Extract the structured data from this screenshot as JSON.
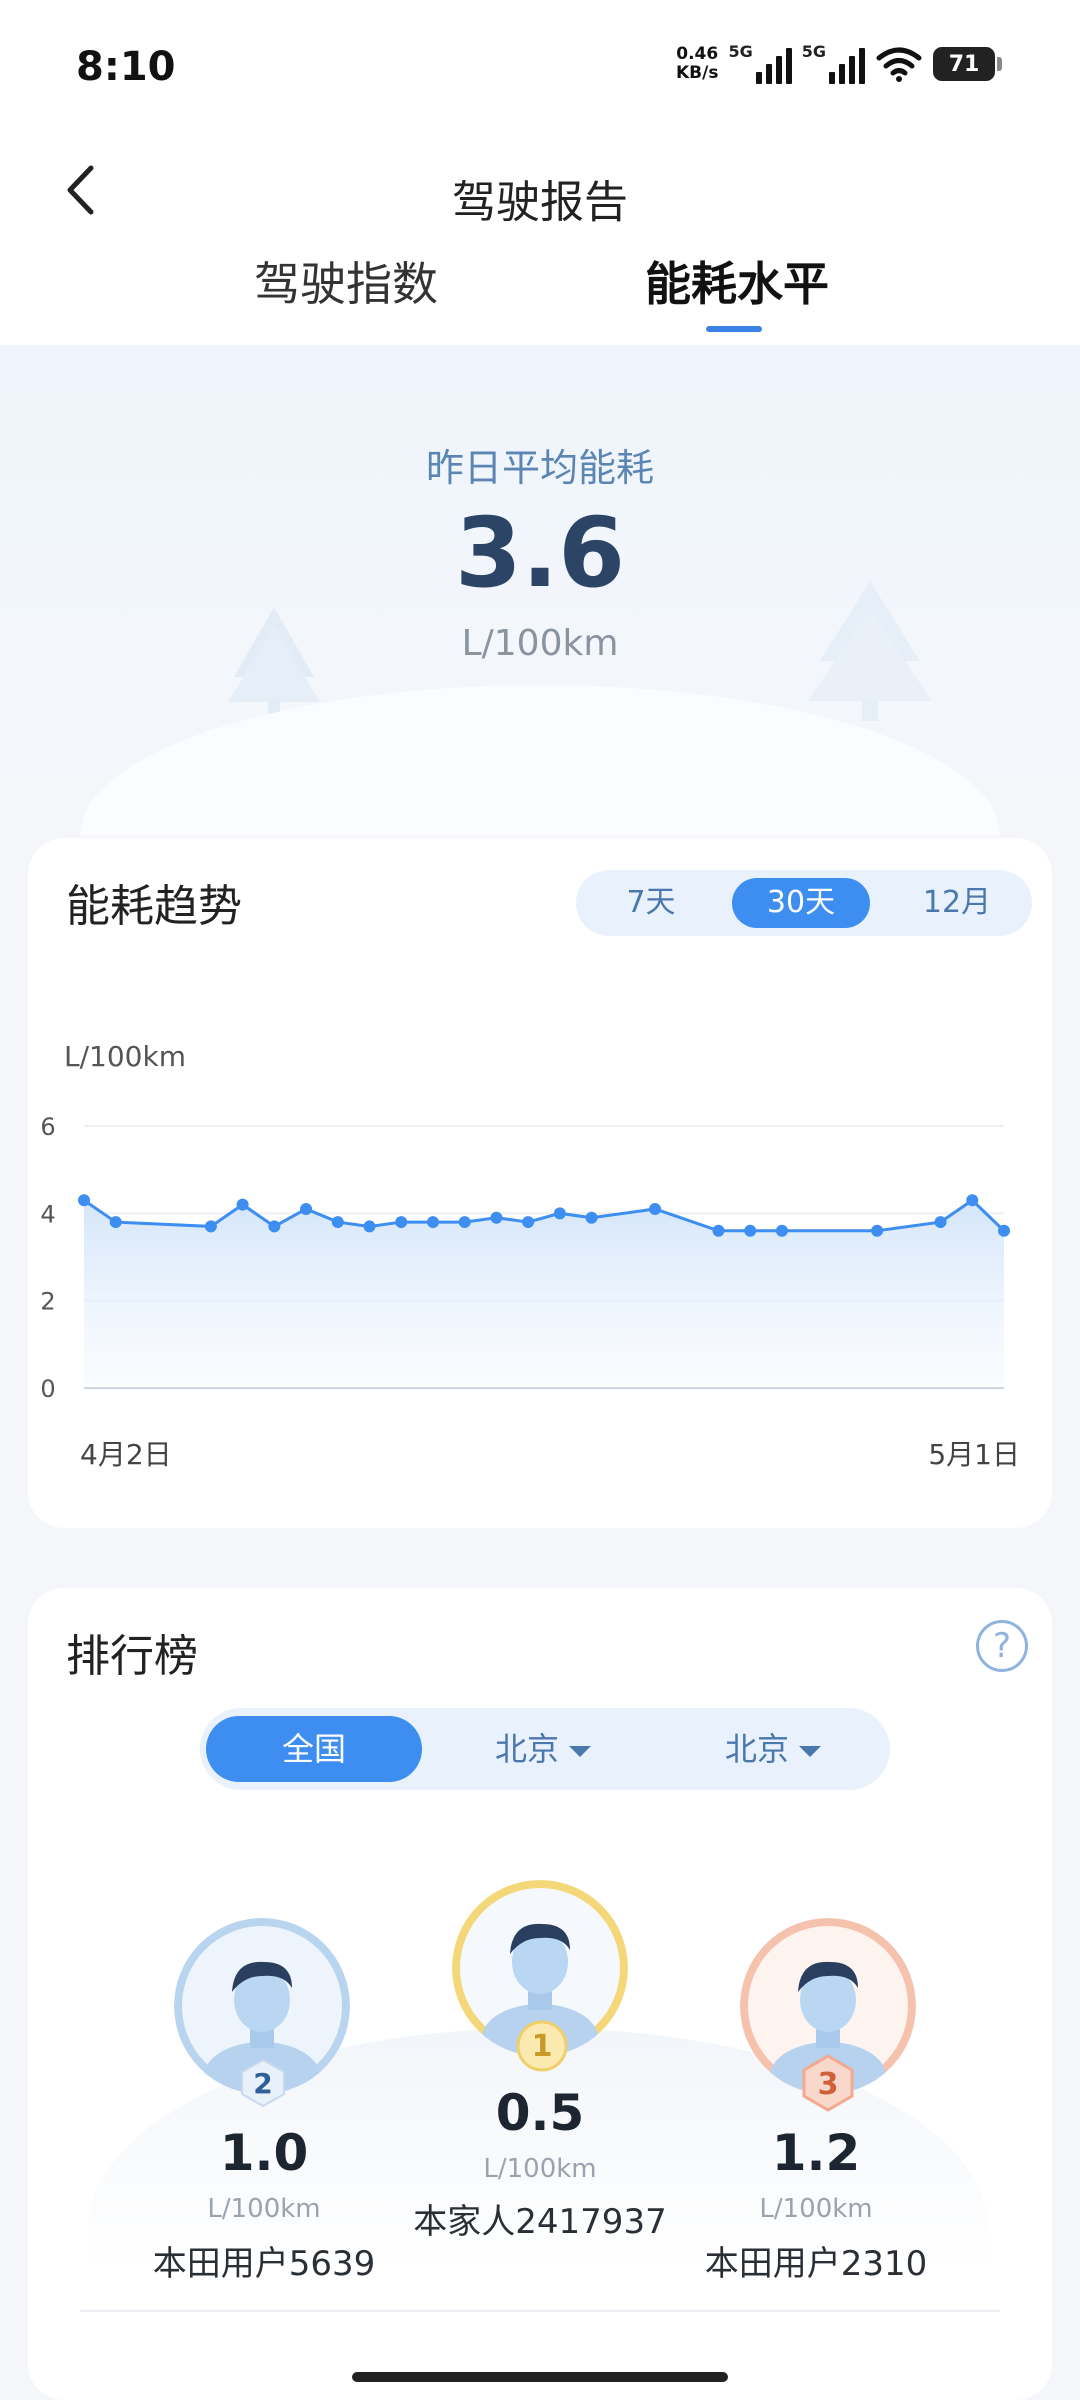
{
  "status_bar": {
    "time": "8:10",
    "net_speed_value": "0.46",
    "net_speed_unit": "KB/s",
    "signal1_label": "5G",
    "signal2_label": "5G",
    "battery": "71"
  },
  "header": {
    "title": "驾驶报告",
    "tabs": [
      {
        "label": "驾驶指数",
        "active": false
      },
      {
        "label": "能耗水平",
        "active": true
      }
    ]
  },
  "hero": {
    "label": "昨日平均能耗",
    "value": "3.6",
    "unit": "L/100km"
  },
  "trend": {
    "title": "能耗趋势",
    "periods": [
      "7天",
      "30天",
      "12月"
    ],
    "selected_period": "30天"
  },
  "chart_data": {
    "type": "area",
    "ylabel": "L/100km",
    "ylim": [
      0,
      6
    ],
    "yticks": [
      "6",
      "4",
      "2",
      "0"
    ],
    "x_start_label": "4月2日",
    "x_end_label": "5月1日",
    "x": [
      1,
      2,
      5,
      6,
      7,
      8,
      9,
      10,
      11,
      12,
      13,
      14,
      15,
      16,
      17,
      19,
      21,
      22,
      23,
      26,
      28,
      29,
      30
    ],
    "values": [
      4.3,
      3.8,
      3.7,
      4.2,
      3.7,
      4.1,
      3.8,
      3.7,
      3.8,
      3.8,
      3.8,
      3.9,
      3.8,
      4.0,
      3.9,
      4.1,
      3.6,
      3.6,
      3.6,
      3.6,
      3.8,
      4.3,
      3.6
    ],
    "line_color": "#3d8ef0",
    "grid": true
  },
  "ranking": {
    "title": "排行榜",
    "help_icon": "question-icon",
    "regions": [
      {
        "label": "全国",
        "active": true,
        "dropdown": false
      },
      {
        "label": "北京",
        "active": false,
        "dropdown": true
      },
      {
        "label": "北京",
        "active": false,
        "dropdown": true
      }
    ],
    "podium": [
      {
        "rank": "2",
        "value": "1.0",
        "unit": "L/100km",
        "name": "本田用户5639"
      },
      {
        "rank": "1",
        "value": "0.5",
        "unit": "L/100km",
        "name": "本家人2417937"
      },
      {
        "rank": "3",
        "value": "1.2",
        "unit": "L/100km",
        "name": "本田用户2310"
      }
    ]
  }
}
